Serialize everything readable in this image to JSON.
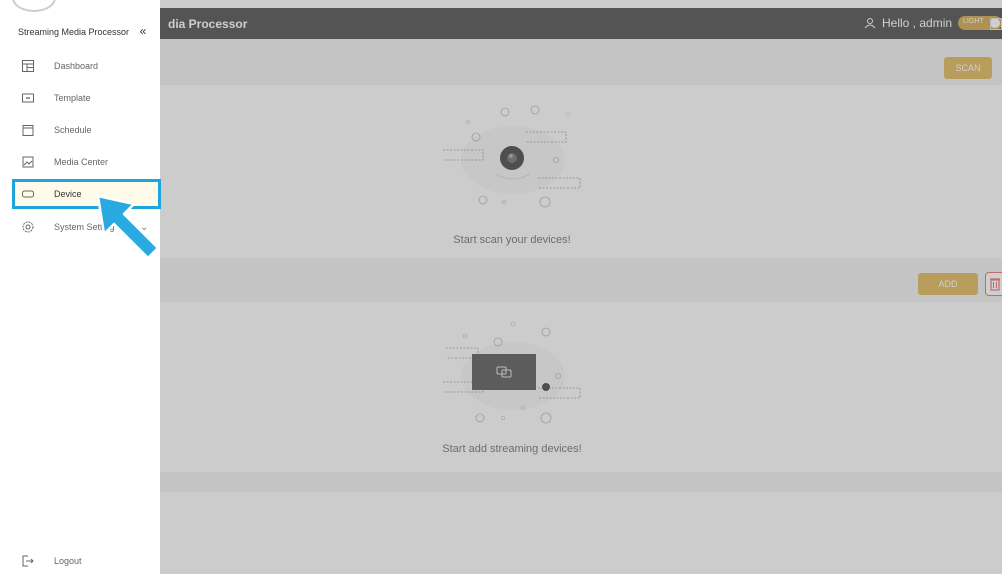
{
  "header": {
    "title": "dia Processor",
    "greeting": "Hello , admin",
    "theme_toggle_label": "LIGHT",
    "user_icon": "user-icon",
    "expand_icon": "fullscreen-icon"
  },
  "sidebar": {
    "app_name": "Streaming Media Processor",
    "collapse_label": "«",
    "items": [
      {
        "label": "Dashboard",
        "icon": "dashboard-icon"
      },
      {
        "label": "Template",
        "icon": "template-icon"
      },
      {
        "label": "Schedule",
        "icon": "schedule-icon"
      },
      {
        "label": "Media Center",
        "icon": "media-center-icon"
      },
      {
        "label": "Device",
        "icon": "device-icon",
        "selected": true
      },
      {
        "label": "System Setting",
        "icon": "settings-icon",
        "expandable": true
      }
    ],
    "logout_label": "Logout"
  },
  "scan_section": {
    "button_label": "SCAN",
    "empty_message": "Start scan your devices!"
  },
  "device_section": {
    "add_label": "ADD",
    "empty_message": "Start add streaming devices!"
  },
  "colors": {
    "accent": "#d8aa3a",
    "highlight": "#1ea5dd",
    "topbar": "#2b2b2b",
    "danger": "#dd5555"
  }
}
